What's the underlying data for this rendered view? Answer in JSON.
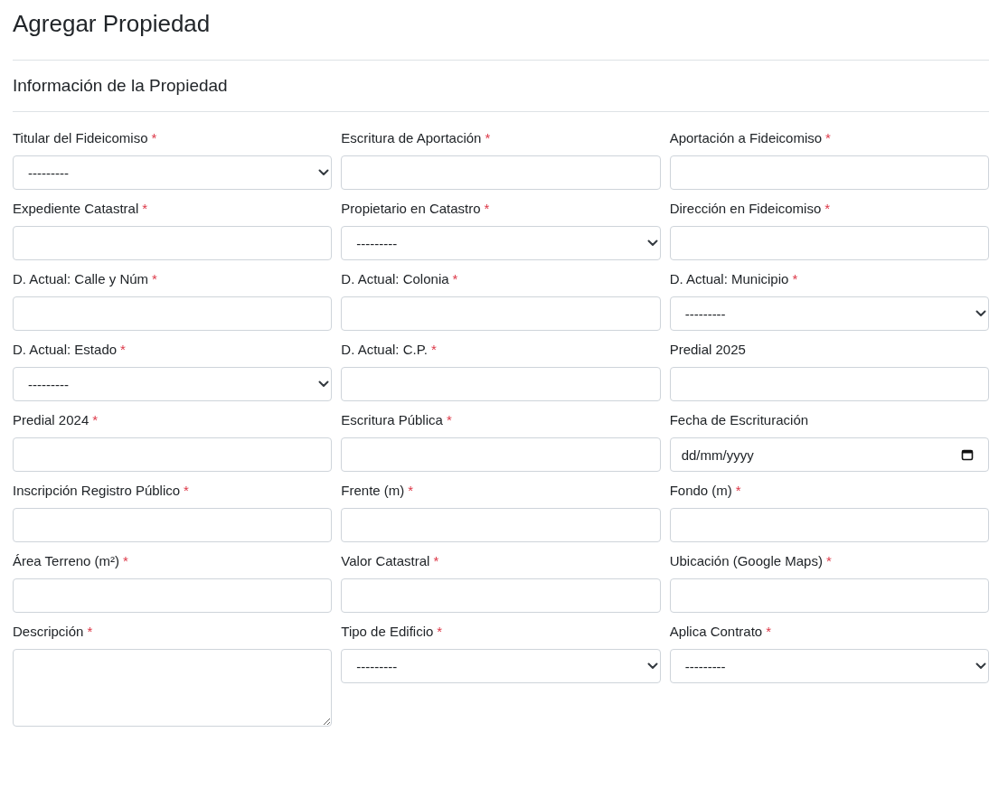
{
  "page_title": "Agregar Propiedad",
  "section_title": "Información de la Propiedad",
  "fields": [
    {
      "label": "Titular del Fideicomiso",
      "required_mark": "*",
      "kind": "select",
      "value": "---------"
    },
    {
      "label": "Escritura de Aportación",
      "required_mark": "*",
      "kind": "text"
    },
    {
      "label": "Aportación a Fideicomiso",
      "required_mark": "*",
      "kind": "text"
    },
    {
      "label": "Expediente Catastral",
      "required_mark": "*",
      "kind": "text"
    },
    {
      "label": "Propietario en Catastro",
      "required_mark": "*",
      "kind": "select",
      "value": "---------"
    },
    {
      "label": "Dirección en Fideicomiso",
      "required_mark": "*",
      "kind": "text"
    },
    {
      "label": "D. Actual: Calle y Núm",
      "required_mark": "*",
      "kind": "text"
    },
    {
      "label": "D. Actual: Colonia",
      "required_mark": "*",
      "kind": "text"
    },
    {
      "label": "D. Actual: Municipio",
      "required_mark": "*",
      "kind": "select",
      "value": "---------"
    },
    {
      "label": "D. Actual: Estado",
      "required_mark": "*",
      "kind": "select",
      "value": "---------"
    },
    {
      "label": "D. Actual: C.P.",
      "required_mark": "*",
      "kind": "text"
    },
    {
      "label": "Predial 2025",
      "kind": "text"
    },
    {
      "label": "Predial 2024",
      "required_mark": "*",
      "kind": "text"
    },
    {
      "label": "Escritura Pública",
      "required_mark": "*",
      "kind": "text"
    },
    {
      "label": "Fecha de Escrituración",
      "kind": "date",
      "placeholder": "dd/mm/yyyy"
    },
    {
      "label": "Inscripción Registro Público",
      "required_mark": "*",
      "kind": "text"
    },
    {
      "label": "Frente (m)",
      "required_mark": "*",
      "kind": "text"
    },
    {
      "label": "Fondo (m)",
      "required_mark": "*",
      "kind": "text"
    },
    {
      "label": "Área Terreno (m²)",
      "required_mark": "*",
      "kind": "text"
    },
    {
      "label": "Valor Catastral",
      "required_mark": "*",
      "kind": "text"
    },
    {
      "label": "Ubicación (Google Maps)",
      "required_mark": "*",
      "kind": "text"
    },
    {
      "label": "Descripción",
      "required_mark": "*",
      "kind": "textarea"
    },
    {
      "label": "Tipo de Edificio",
      "required_mark": "*",
      "kind": "select",
      "value": "---------"
    },
    {
      "label": "Aplica Contrato",
      "required_mark": "*",
      "kind": "select",
      "value": "---------"
    }
  ]
}
